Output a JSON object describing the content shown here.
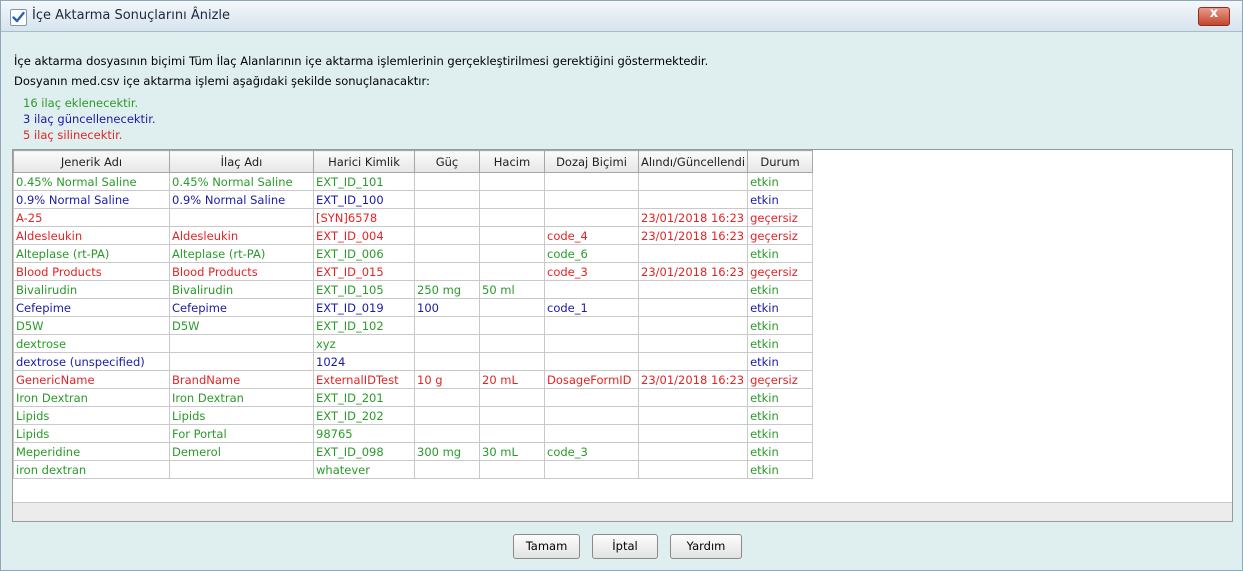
{
  "window": {
    "title": "İçe Aktarma Sonuçlarını Ânizle",
    "close_label": "x"
  },
  "message": {
    "line1": "İçe aktarma dosyasının biçimi Tüm İlaç Alanlarının içe aktarma işlemlerinin gerçekleştirilmesi gerektiğini göstermektedir.",
    "line2": "Dosyanın med.csv içe aktarma işlemi aşağıdaki şekilde sonuçlanacaktır:"
  },
  "summary": {
    "added": "16 ilaç eklenecektir.",
    "updated": "3 ilaç güncellenecektir.",
    "deleted": "5 ilaç silinecektir."
  },
  "colors": {
    "added": "#2a9a2a",
    "updated": "#1a1aa8",
    "deleted": "#e32424"
  },
  "table": {
    "columns": [
      "Jenerik Adı",
      "İlaç Adı",
      "Harici Kimlik",
      "Güç",
      "Hacim",
      "Dozaj Biçimi",
      "Alındı/Güncellendi",
      "Durum"
    ],
    "rows": [
      {
        "status": "added",
        "cells": [
          "0.45% Normal Saline",
          "0.45% Normal Saline",
          "EXT_ID_101",
          "",
          "",
          "",
          "",
          "etkin"
        ]
      },
      {
        "status": "updated",
        "cells": [
          "0.9% Normal Saline",
          "0.9% Normal Saline",
          "EXT_ID_100",
          "",
          "",
          "",
          "",
          "etkin"
        ]
      },
      {
        "status": "deleted",
        "cells": [
          "A-25",
          "",
          "[SYN]6578",
          "",
          "",
          "",
          "23/01/2018 16:23",
          "geçersiz"
        ]
      },
      {
        "status": "deleted",
        "cells": [
          "Aldesleukin",
          "Aldesleukin",
          "EXT_ID_004",
          "",
          "",
          "code_4",
          "23/01/2018 16:23",
          "geçersiz"
        ]
      },
      {
        "status": "added",
        "cells": [
          "Alteplase (rt-PA)",
          "Alteplase (rt-PA)",
          "EXT_ID_006",
          "",
          "",
          "code_6",
          "",
          "etkin"
        ]
      },
      {
        "status": "deleted",
        "cells": [
          "Blood Products",
          "Blood Products",
          "EXT_ID_015",
          "",
          "",
          "code_3",
          "23/01/2018 16:23",
          "geçersiz"
        ]
      },
      {
        "status": "added",
        "cells": [
          "Bivalirudin",
          "Bivalirudin",
          "EXT_ID_105",
          "250 mg",
          "50 ml",
          "",
          "",
          "etkin"
        ]
      },
      {
        "status": "updated",
        "cells": [
          "Cefepime",
          "Cefepime",
          "EXT_ID_019",
          "100",
          "",
          "code_1",
          "",
          "etkin"
        ]
      },
      {
        "status": "added",
        "cells": [
          "D5W",
          "D5W",
          "EXT_ID_102",
          "",
          "",
          "",
          "",
          "etkin"
        ]
      },
      {
        "status": "added",
        "cells": [
          "dextrose",
          "",
          "xyz",
          "",
          "",
          "",
          "",
          "etkin"
        ]
      },
      {
        "status": "updated",
        "cells": [
          "dextrose (unspecified)",
          "",
          "1024",
          "",
          "",
          "",
          "",
          "etkin"
        ]
      },
      {
        "status": "deleted",
        "cells": [
          "GenericName",
          "BrandName",
          "ExternalIDTest",
          "10 g",
          "20 mL",
          "DosageFormID",
          "23/01/2018 16:23",
          "geçersiz"
        ]
      },
      {
        "status": "added",
        "cells": [
          "Iron Dextran",
          "Iron Dextran",
          "EXT_ID_201",
          "",
          "",
          "",
          "",
          "etkin"
        ]
      },
      {
        "status": "added",
        "cells": [
          "Lipids",
          "Lipids",
          "EXT_ID_202",
          "",
          "",
          "",
          "",
          "etkin"
        ]
      },
      {
        "status": "added",
        "cells": [
          "Lipids",
          "For Portal",
          "98765",
          "",
          "",
          "",
          "",
          "etkin"
        ]
      },
      {
        "status": "added",
        "cells": [
          "Meperidine",
          "Demerol",
          "EXT_ID_098",
          "300 mg",
          "30 mL",
          "code_3",
          "",
          "etkin"
        ]
      },
      {
        "status": "added",
        "cells": [
          "iron dextran",
          "",
          "whatever",
          "",
          "",
          "",
          "",
          "etkin"
        ]
      }
    ]
  },
  "buttons": {
    "ok": "Tamam",
    "cancel": "İptal",
    "help": "Yardım"
  }
}
